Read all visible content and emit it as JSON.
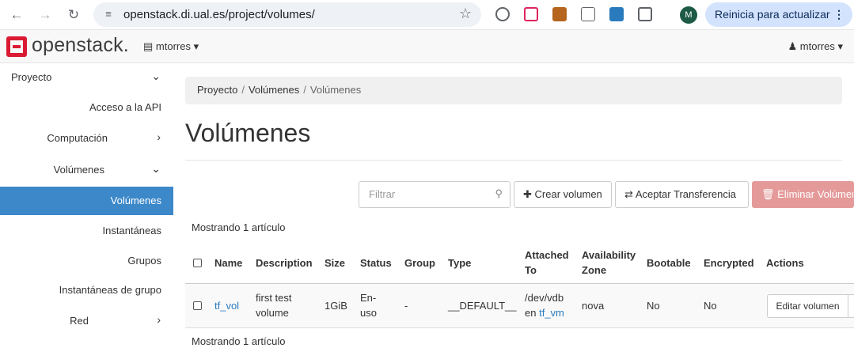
{
  "browser": {
    "url": "openstack.di.ual.es/project/volumes/",
    "profile_initial": "M",
    "update_label": "Reinicia para actualizar"
  },
  "header": {
    "logo_text": "openstack.",
    "project": "mtorres",
    "user": "mtorres"
  },
  "sidebar": {
    "items": [
      {
        "label": "Proyecto"
      },
      {
        "label": "Acceso a la API"
      },
      {
        "label": "Computación"
      },
      {
        "label": "Volúmenes"
      },
      {
        "label": "Volúmenes"
      },
      {
        "label": "Instantáneas"
      },
      {
        "label": "Grupos"
      },
      {
        "label": "Instantáneas de grupo"
      },
      {
        "label": "Red"
      }
    ]
  },
  "breadcrumb": [
    "Proyecto",
    "Volúmenes",
    "Volúmenes"
  ],
  "page_title": "Volúmenes",
  "toolbar": {
    "filter_placeholder": "Filtrar",
    "create": "Crear volumen",
    "accept_transfer": "Aceptar Transferencia",
    "delete": "Eliminar Volúmenes"
  },
  "count_text": "Mostrando 1 artículo",
  "table": {
    "headers": {
      "name": "Name",
      "description": "Description",
      "size": "Size",
      "status": "Status",
      "group": "Group",
      "type": "Type",
      "attached_1": "Attached",
      "attached_2": "To",
      "az_1": "Availability",
      "az_2": "Zone",
      "bootable": "Bootable",
      "encrypted": "Encrypted",
      "actions": "Actions"
    },
    "rows": [
      {
        "name": "tf_vol",
        "description_1": "first test",
        "description_2": "volume",
        "size": "1GiB",
        "status_1": "En-",
        "status_2": "uso",
        "group": "-",
        "type": "__DEFAULT__",
        "attached_1": "/dev/vdb",
        "attached_prefix": "en",
        "attached_vm": "tf_vm",
        "az": "nova",
        "bootable": "No",
        "encrypted": "No",
        "action": "Editar volumen"
      }
    ]
  }
}
